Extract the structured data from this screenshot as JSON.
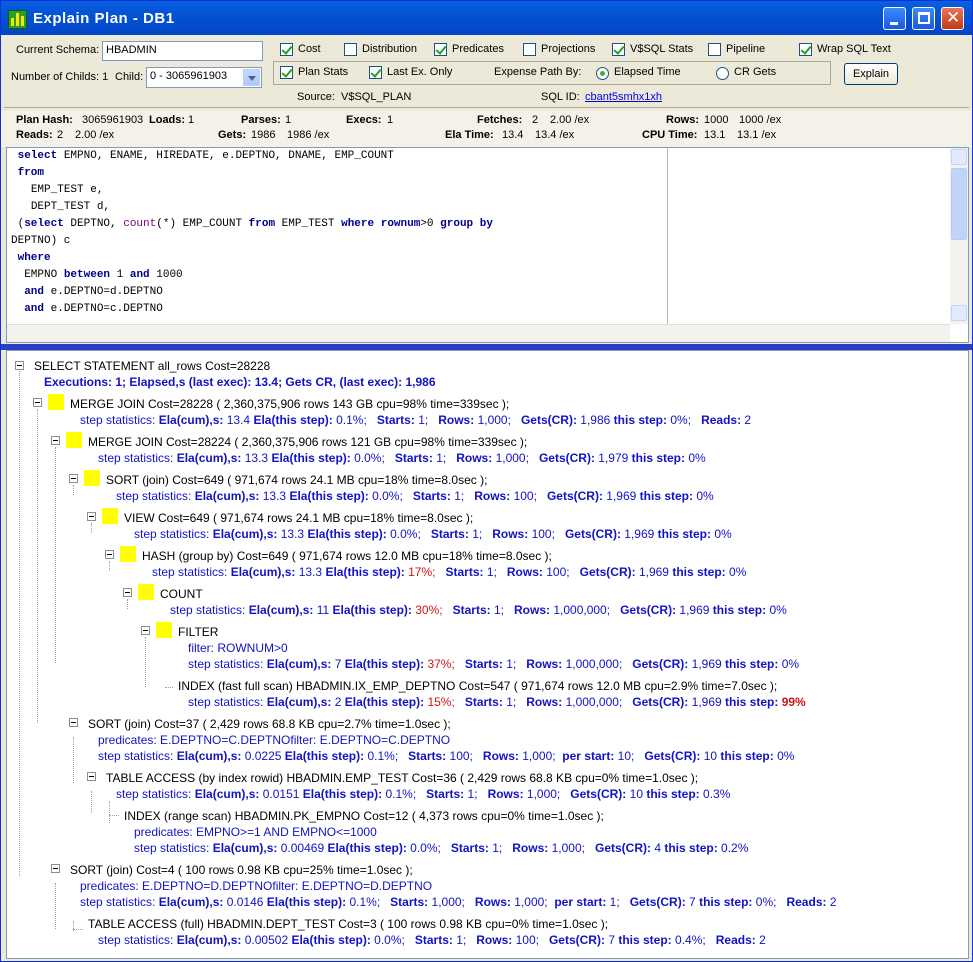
{
  "window": {
    "title": "Explain Plan - DB1"
  },
  "controls": {
    "schema_label": "Current Schema:",
    "schema_value": "HBADMIN",
    "childs_label": "Number of Childs: 1",
    "child_label": "Child:",
    "child_value": "0 - 3065961903",
    "checks": {
      "cost": "Cost",
      "distribution": "Distribution",
      "predicates": "Predicates",
      "projections": "Projections",
      "vsql_stats": "V$SQL Stats",
      "pipeline": "Pipeline",
      "wrap": "Wrap SQL Text",
      "plan_stats": "Plan Stats",
      "last_ex": "Last Ex. Only"
    },
    "expense_label": "Expense Path By:",
    "elapsed_label": "Elapsed Time",
    "crgets_label": "CR Gets",
    "explain_label": "Explain",
    "source_label": "Source:",
    "source_value": "V$SQL_PLAN",
    "sqlid_label": "SQL ID:",
    "sqlid_value": "cbant5smhx1xh"
  },
  "stats": {
    "plan_hash_l": "Plan Hash:",
    "plan_hash_v": "3065961903",
    "loads_l": "Loads:",
    "loads_v": "1",
    "parses_l": "Parses:",
    "parses_v": "1",
    "execs_l": "Execs:",
    "execs_v": "1",
    "fetches_l": "Fetches:",
    "fetches_v": "2",
    "fetches_ex": "2.00 /ex",
    "rows_l": "Rows:",
    "rows_v": "1000",
    "rows_ex": "1000 /ex",
    "reads_l": "Reads:",
    "reads_v": "2",
    "reads_ex": "2.00 /ex",
    "gets_l": "Gets:",
    "gets_v": "1986",
    "gets_ex": "1986 /ex",
    "ela_l": "Ela Time:",
    "ela_v": "13.4",
    "ela_ex": "13.4 /ex",
    "cpu_l": "CPU Time:",
    "cpu_v": "13.1",
    "cpu_ex": "13.1 /ex"
  },
  "sql_lines": [
    {
      "t": "select",
      "r": " EMPNO, ENAME, HIREDATE, e.DEPTNO, DNAME, EMP_COUNT",
      "ind": " "
    },
    {
      "t": "from",
      "r": "",
      "ind": " "
    },
    {
      "t": "",
      "r": "EMP_TEST e,",
      "ind": "   "
    },
    {
      "t": "",
      "r": "DEPT_TEST d,",
      "ind": "   "
    }
  ],
  "sql_raw": {
    "l5a": " (",
    "l5b": "select",
    "l5c": " DEPTNO, ",
    "l5d": "count",
    "l5e": "(*) EMP_COUNT ",
    "l5f": "from",
    "l5g": " EMP_TEST ",
    "l5h": "where",
    "l5i": " ",
    "l5j": "rownum",
    "l5k": ">0 ",
    "l5l": "group by",
    "l6": "DEPTNO) c",
    "l7": "where",
    "l8a": "  EMPNO ",
    "l8b": "between",
    "l8c": " 1 ",
    "l8d": "and",
    "l8e": " 1000",
    "l9a": "  ",
    "l9b": "and",
    "l9c": " e.DEPTNO=d.DEPTNO",
    "l10a": "  ",
    "l10b": "and",
    "l10c": " e.DEPTNO=c.DEPTNO"
  },
  "tree": {
    "root": "SELECT STATEMENT all_rows  Cost=28228",
    "root_exec": "Executions: 1;   Elapsed,s (last exec): 13.4;   Gets CR, (last exec): 1,986",
    "n1": "MERGE JOIN  Cost=28228  ( 2,360,375,906 rows  143 GB  cpu=98%  time=339sec );",
    "n2": "MERGE JOIN  Cost=28224  ( 2,360,375,906 rows  121 GB  cpu=98%  time=339sec );",
    "n3": "SORT (join)  Cost=649  ( 971,674 rows  24.1 MB  cpu=18%  time=8.0sec );",
    "n4": "VIEW  Cost=649  ( 971,674 rows  24.1 MB  cpu=18%  time=8.0sec );",
    "n5": "HASH (group by)  Cost=649  ( 971,674 rows  12.0 MB  cpu=18%  time=8.0sec );",
    "n6": "COUNT",
    "n7": "FILTER",
    "n7_filter": "filter: ROWNUM>0",
    "n8": "INDEX (fast full scan)  HBADMIN.IX_EMP_DEPTNO   Cost=547  ( 971,674 rows  12.0 MB  cpu=2.9%  time=7.0sec );",
    "n9": "SORT (join)   Cost=37  ( 2,429 rows  68.8 KB  cpu=2.7%  time=1.0sec );",
    "n9_pred": "predicates: E.DEPTNO=C.DEPTNOfilter: E.DEPTNO=C.DEPTNO",
    "n10": "TABLE ACCESS (by index rowid)  HBADMIN.EMP_TEST   Cost=36  ( 2,429 rows  68.8 KB  cpu=0%  time=1.0sec );",
    "n11": "INDEX (range scan)  HBADMIN.PK_EMPNO   Cost=12  ( 4,373 rows   cpu=0%  time=1.0sec );",
    "n11_pred": "predicates: EMPNO>=1 AND EMPNO<=1000",
    "n12": "SORT (join)   Cost=4  ( 100 rows  0.98 KB  cpu=25%  time=1.0sec );",
    "n12_pred": "predicates: E.DEPTNO=D.DEPTNOfilter: E.DEPTNO=D.DEPTNO",
    "n13": "TABLE ACCESS (full)  HBADMIN.DEPT_TEST   Cost=3  ( 100 rows  0.98 KB  cpu=0%  time=1.0sec );",
    "ss": "step statistics:",
    "ela_cum": "Ela(cum),s:",
    "ela_step": "Ela(this step):",
    "starts": "Starts:",
    "rows": "Rows:",
    "gets": "Gets(CR):",
    "this_step": "this step:",
    "reads": "Reads:",
    "per_start": "per start:",
    "s1": {
      "cum": "13.4",
      "step": "0.1%;",
      "starts": "1;",
      "rows": "1,000;",
      "gets": "1,986",
      "ts": "0%;",
      "reads": "2"
    },
    "s2": {
      "cum": "13.3",
      "step": "0.0%;",
      "starts": "1;",
      "rows": "1,000;",
      "gets": "1,979",
      "ts": "0%"
    },
    "s3": {
      "cum": "13.3",
      "step": "0.0%;",
      "starts": "1;",
      "rows": "100;",
      "gets": "1,969",
      "ts": "0%"
    },
    "s4": {
      "cum": "13.3",
      "step": "0.0%;",
      "starts": "1;",
      "rows": "100;",
      "gets": "1,969",
      "ts": "0%"
    },
    "s5": {
      "cum": "13.3",
      "step": "17%;",
      "starts": "1;",
      "rows": "100;",
      "gets": "1,969",
      "ts": "0%"
    },
    "s6": {
      "cum": "11",
      "step": "30%;",
      "starts": "1;",
      "rows": "1,000,000;",
      "gets": "1,969",
      "ts": "0%"
    },
    "s7": {
      "cum": "7",
      "step": "37%;",
      "starts": "1;",
      "rows": "1,000,000;",
      "gets": "1,969",
      "ts": "0%"
    },
    "s8": {
      "cum": "2",
      "step": "15%;",
      "starts": "1;",
      "rows": "1,000,000;",
      "gets": "1,969",
      "ts": "99%"
    },
    "s9": {
      "cum": "0.0225",
      "step": "0.1%;",
      "starts": "100;",
      "rows": "1,000;",
      "per": "10;",
      "gets": "10",
      "ts": "0%"
    },
    "s10": {
      "cum": "0.0151",
      "step": "0.1%;",
      "starts": "1;",
      "rows": "1,000;",
      "gets": "10",
      "ts": "0.3%"
    },
    "s11": {
      "cum": "0.00469",
      "step": "0.0%;",
      "starts": "1;",
      "rows": "1,000;",
      "gets": "4",
      "ts": "0.2%"
    },
    "s12": {
      "cum": "0.0146",
      "step": "0.1%;",
      "starts": "1,000;",
      "rows": "1,000;",
      "per": "1;",
      "gets": "7",
      "ts": "0%;",
      "reads": "2"
    },
    "s13": {
      "cum": "0.00502",
      "step": "0.0%;",
      "starts": "1;",
      "rows": "100;",
      "gets": "7",
      "ts": "0.4%;",
      "reads": "2"
    }
  }
}
